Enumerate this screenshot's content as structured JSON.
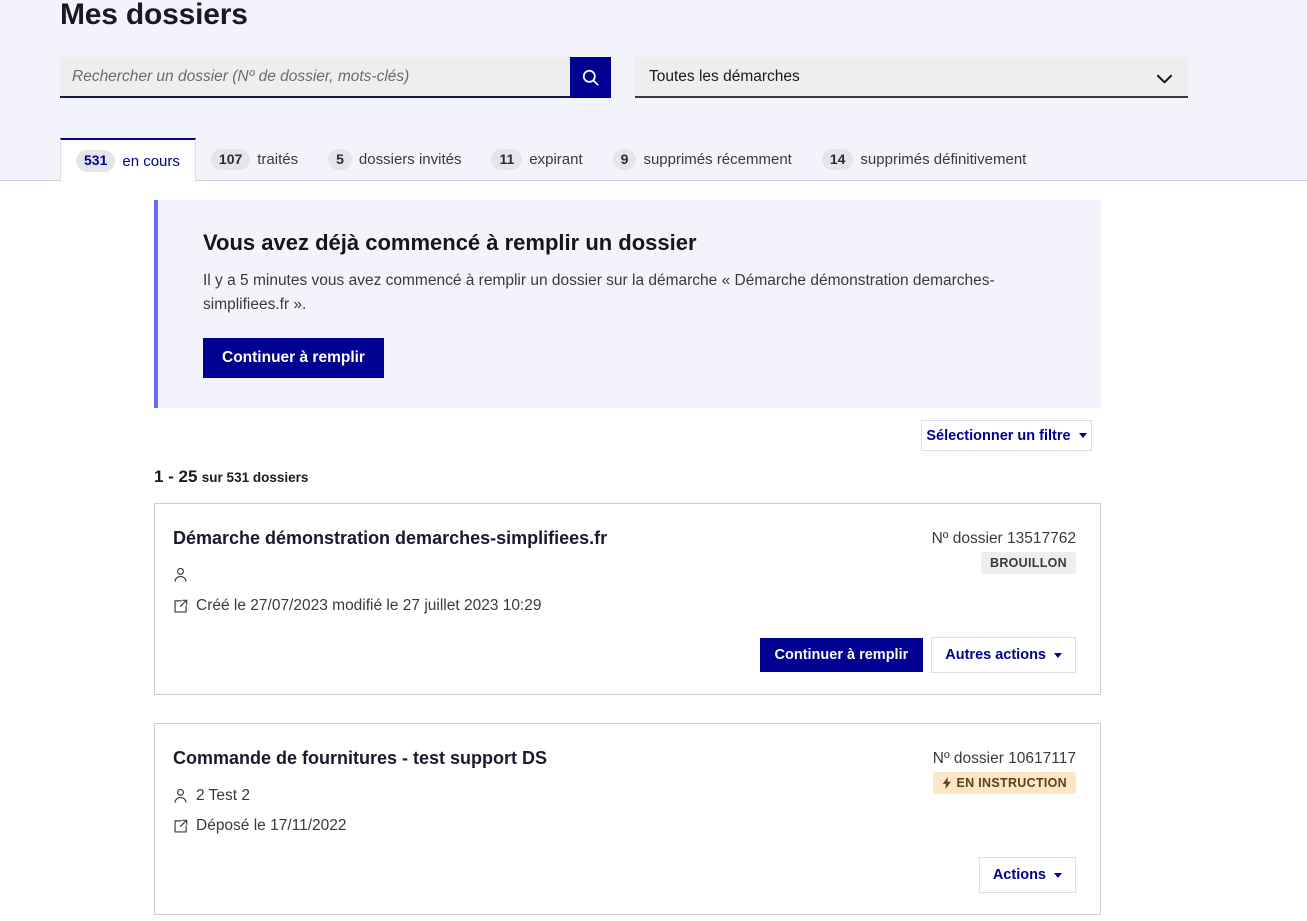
{
  "header": {
    "title": "Mes dossiers"
  },
  "search": {
    "placeholder": "Rechercher un dossier (Nº de dossier, mots-clés)",
    "value": "",
    "button_icon": "search-icon"
  },
  "demarche_select": {
    "selected": "Toutes les démarches",
    "options": [
      "Toutes les démarches"
    ],
    "chevron_icon": "chevron-down-icon"
  },
  "tabs": [
    {
      "count": "531",
      "label": "en cours",
      "active": true
    },
    {
      "count": "107",
      "label": "traités",
      "active": false
    },
    {
      "count": "5",
      "label": "dossiers invités",
      "active": false
    },
    {
      "count": "11",
      "label": "expirant",
      "active": false
    },
    {
      "count": "9",
      "label": "supprimés récemment",
      "active": false
    },
    {
      "count": "14",
      "label": "supprimés définitivement",
      "active": false
    }
  ],
  "alert": {
    "title": "Vous avez déjà commencé à remplir un dossier",
    "text": "Il y a 5 minutes vous avez commencé à remplir un dossier sur la démarche « Démarche démonstration demarches-simplifiees.fr ».",
    "button_label": "Continuer à remplir"
  },
  "filter": {
    "label": "Sélectionner un filtre",
    "caret_icon": "caret-down-icon"
  },
  "pagination": {
    "range": "1 - 25",
    "total_text": "sur 531 dossiers"
  },
  "dossiers": [
    {
      "title": "Démarche démonstration demarches-simplifiees.fr",
      "user": "",
      "user_icon": "person-icon",
      "date_icon": "edit-square-icon",
      "date": "Créé le 27/07/2023 modifié le 27 juillet 2023 10:29",
      "number_label": "Nº dossier 13517762",
      "badge": {
        "label": "BROUILLON",
        "style": "brouillon",
        "icon": ""
      },
      "actions": [
        {
          "label": "Continuer à remplir",
          "style": "primary"
        },
        {
          "label": "Autres actions",
          "style": "ghost",
          "caret": true
        }
      ]
    },
    {
      "title": "Commande de fournitures - test support DS",
      "user": "2 Test 2",
      "user_icon": "person-icon",
      "date_icon": "edit-square-icon",
      "date": "Déposé le 17/11/2022",
      "number_label": "Nº dossier 10617117",
      "badge": {
        "label": "EN INSTRUCTION",
        "style": "instruction",
        "icon": "bolt-icon"
      },
      "actions": [
        {
          "label": "Actions",
          "style": "ghost",
          "caret": true
        }
      ]
    }
  ],
  "colors": {
    "brand_blue": "#000091",
    "accent_periwinkle": "#6a6af4",
    "header_bg": "#f3f3fb",
    "badge_instruction_bg": "#fbe7c8"
  }
}
